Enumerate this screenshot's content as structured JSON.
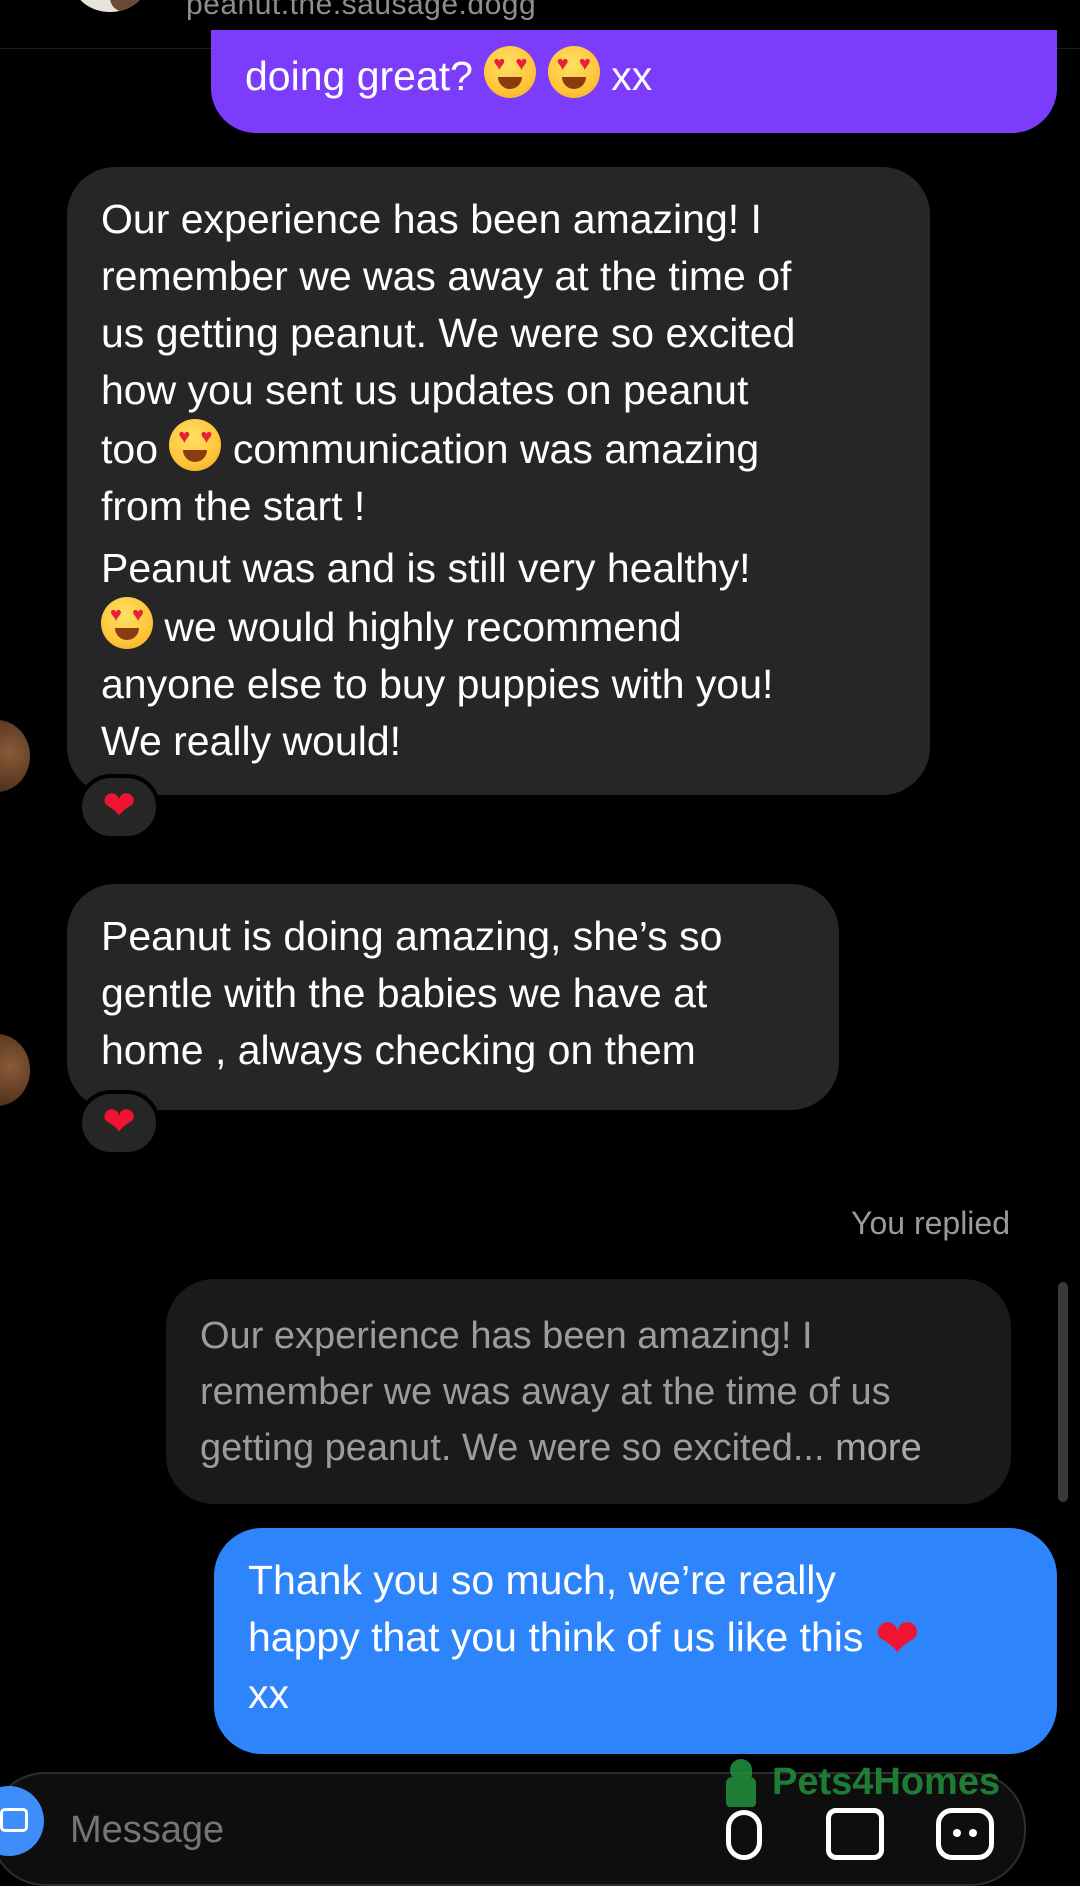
{
  "header": {
    "username": "peanut.the.sausage.dogg"
  },
  "messages": {
    "top_outgoing": {
      "text": "doing great?",
      "suffix": "xx"
    },
    "incoming_1": {
      "line1": "Our experience has been amazing! I",
      "line2": "remember we was away at the time of",
      "line3": "us getting peanut. We were so excited",
      "line4": "how you sent us updates on peanut",
      "line5a": "too",
      "line5b": "communication was amazing",
      "line6": "from the start !",
      "p2_line1": "Peanut was and is still very healthy!",
      "p2_line2b": "we would highly recommend",
      "p2_line3": "anyone else to buy puppies with you!",
      "p2_line4": "We really would!"
    },
    "incoming_1_reaction": "❤",
    "incoming_2": {
      "line1": "Peanut is doing amazing, she’s so",
      "line2": "gentle with the babies we have at",
      "line3": "home , always checking on them"
    },
    "incoming_2_reaction": "❤",
    "you_replied_label": "You replied",
    "quoted_reply": {
      "line1": "Our experience has been amazing! I",
      "line2": "remember we was away at the time of us",
      "line3": "getting peanut. We were so excited...",
      "more": "more"
    },
    "outgoing_reply": {
      "line1": "Thank you so much, we’re really",
      "line2": "happy that you think of us like this",
      "heart": "❤",
      "line3": "xx"
    }
  },
  "composer": {
    "placeholder": "Message"
  },
  "watermark": {
    "text": "Pets4Homes"
  },
  "colors": {
    "outgoing_purple": "#7b3dfb",
    "outgoing_blue": "#2d84fb",
    "incoming_gray": "#262626",
    "watermark_green": "#1f8a3a"
  },
  "icons": [
    "heart-eyes-emoji-icon",
    "red-heart-icon",
    "camera-icon",
    "microphone-icon",
    "gallery-icon",
    "sticker-icon"
  ]
}
